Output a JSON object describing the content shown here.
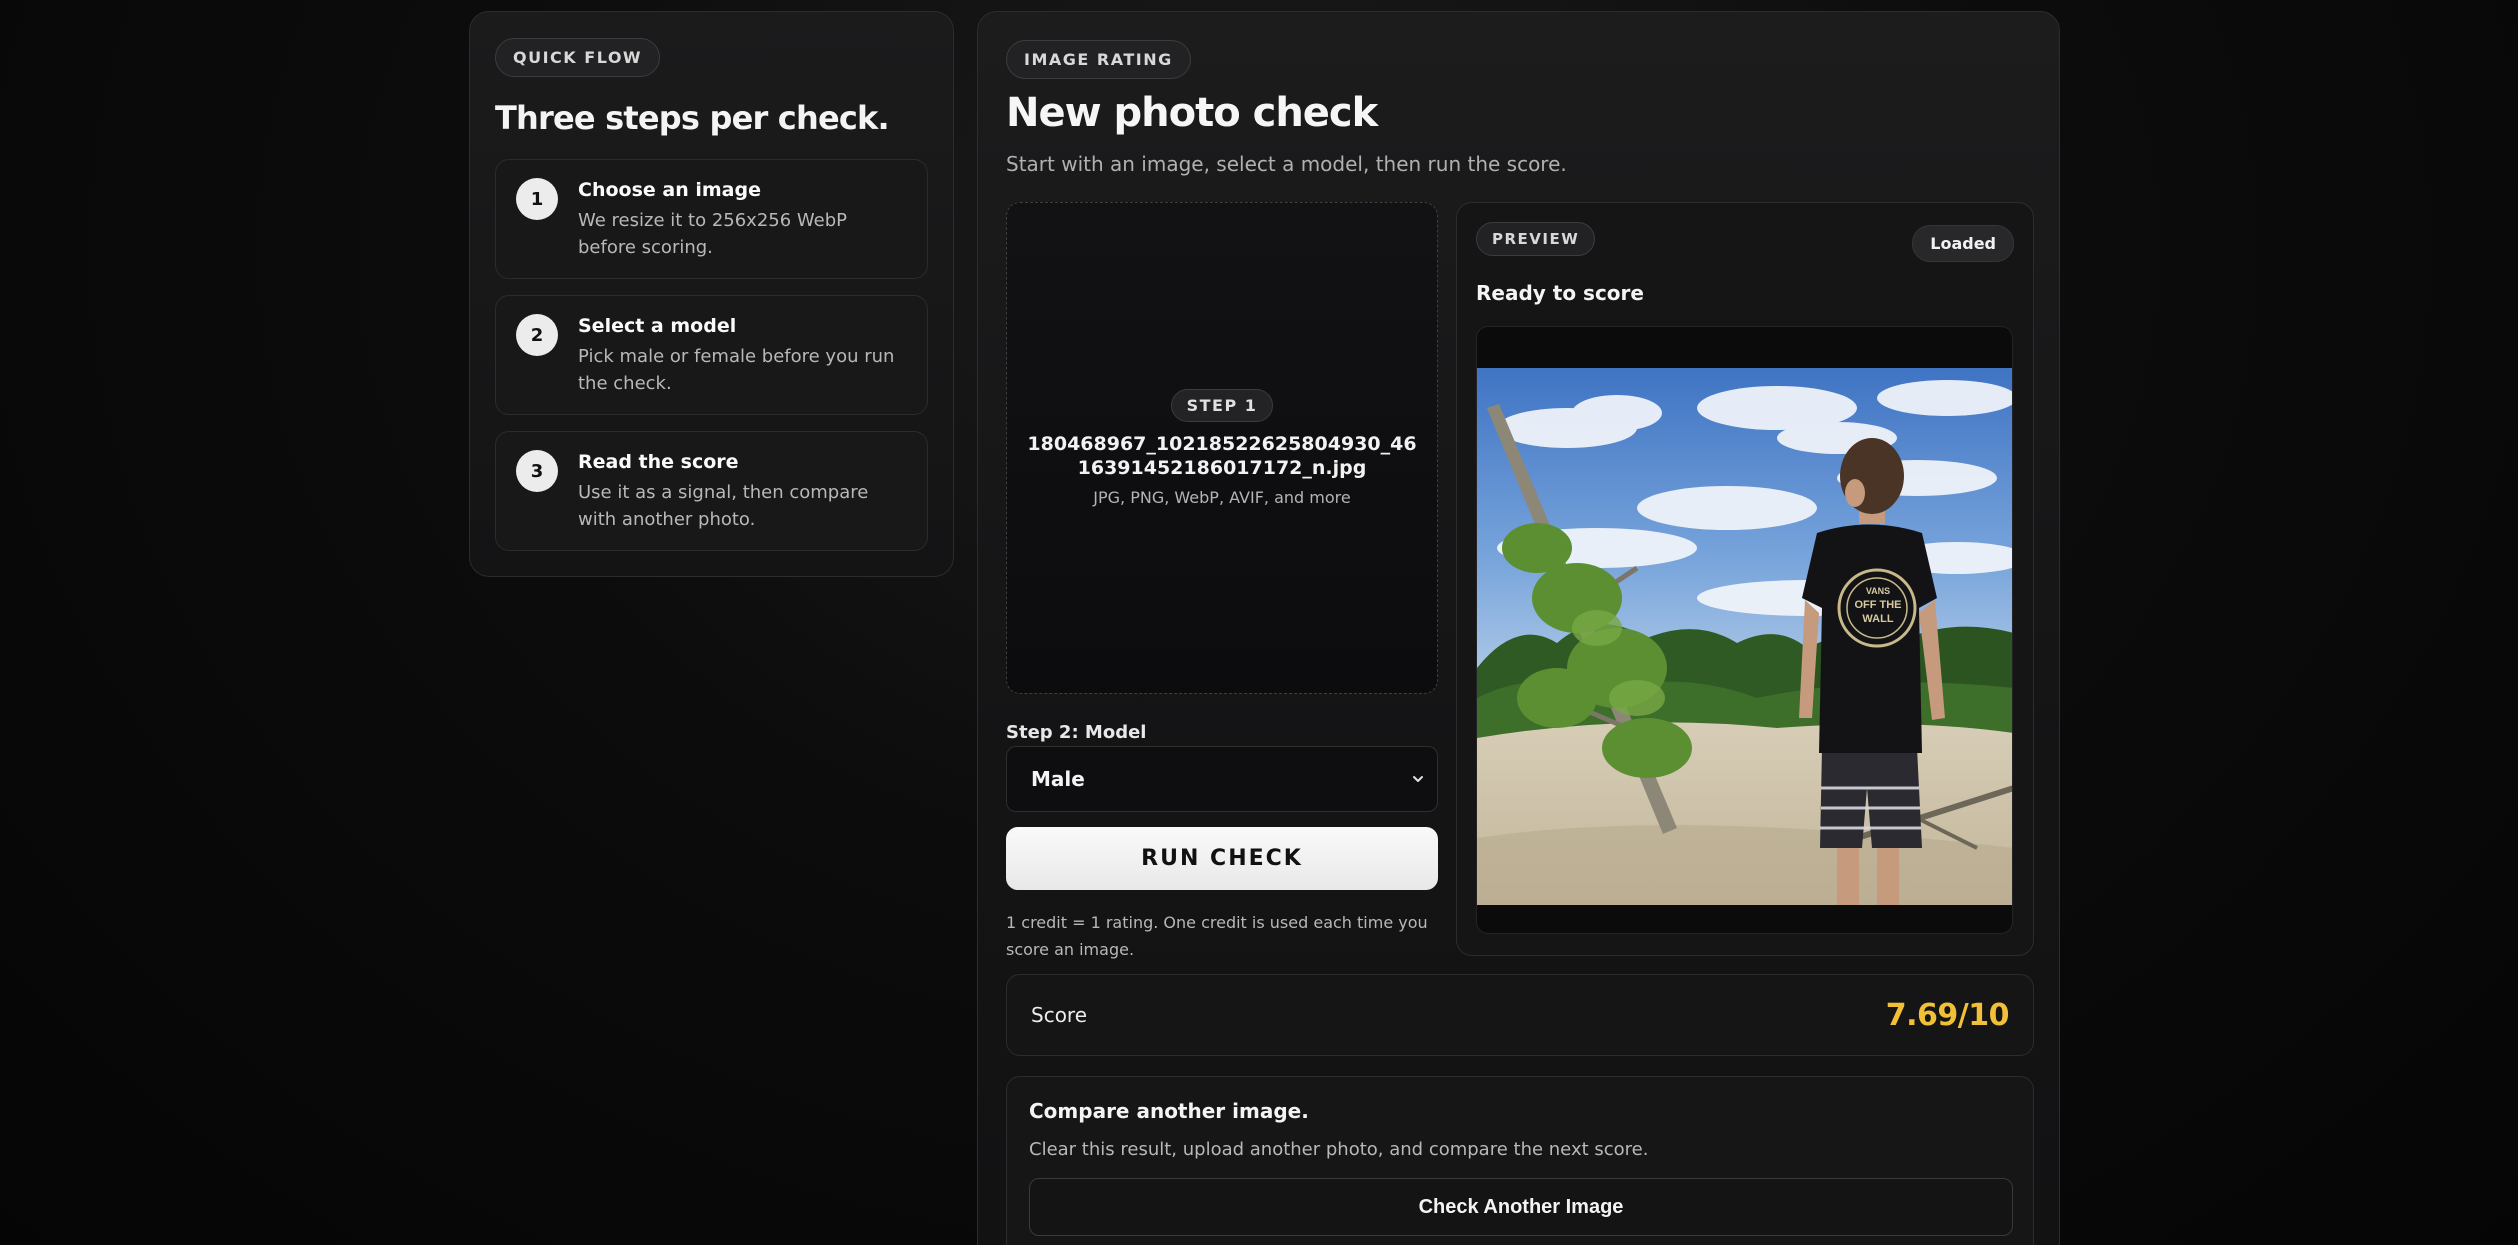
{
  "quick_flow": {
    "pill": "QUICK FLOW",
    "title": "Three steps per check.",
    "steps": [
      {
        "number": "1",
        "heading": "Choose an image",
        "desc": "We resize it to 256x256 WebP before scoring."
      },
      {
        "number": "2",
        "heading": "Select a model",
        "desc": "Pick male or female before you run the check."
      },
      {
        "number": "3",
        "heading": "Read the score",
        "desc": "Use it as a signal, then compare with another photo."
      }
    ]
  },
  "main": {
    "pill": "IMAGE RATING",
    "title": "New photo check",
    "subtitle": "Start with an image, select a model, then run the score."
  },
  "upload": {
    "step_pill": "STEP 1",
    "filename": "180468967_10218522625804930_4616391452186017172_n.jpg",
    "formats": "JPG, PNG, WebP, AVIF, and more"
  },
  "model": {
    "label": "Step 2: Model",
    "selected": "Male"
  },
  "run": {
    "button_label": "RUN CHECK",
    "credit_note": "1 credit = 1 rating. One credit is used each time you score an image."
  },
  "preview": {
    "pill": "PREVIEW",
    "badge": "Loaded",
    "status": "Ready to score",
    "shirt_text": "OFF THE WALL",
    "shirt_brand": "VANS"
  },
  "score": {
    "label": "Score",
    "value": "7.69/10"
  },
  "compare": {
    "title": "Compare another image.",
    "desc": "Clear this result, upload another photo, and compare the next score.",
    "button_label": "Check Another Image"
  },
  "colors": {
    "score_accent": "#f2c037",
    "background": "#070707"
  }
}
